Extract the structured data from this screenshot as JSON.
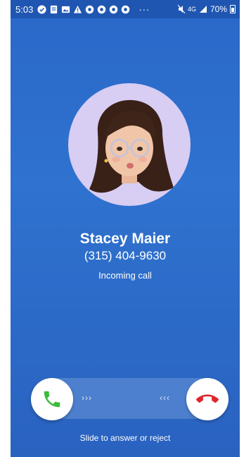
{
  "status_bar": {
    "time": "5:03",
    "network": "4G",
    "battery": "70%"
  },
  "caller": {
    "name": "Stacey Maier",
    "number": "(315) 404-9630",
    "status": "Incoming call"
  },
  "slider": {
    "right_arrows": "›››",
    "left_arrows": "‹‹‹",
    "hint": "Slide to answer or reject"
  },
  "colors": {
    "background": "#2a68c8",
    "answer": "#3dbb3d",
    "reject": "#e0262a"
  },
  "icons": {
    "answer": "phone-icon",
    "reject": "hang-up-icon",
    "avatar": "memoji-avatar"
  }
}
